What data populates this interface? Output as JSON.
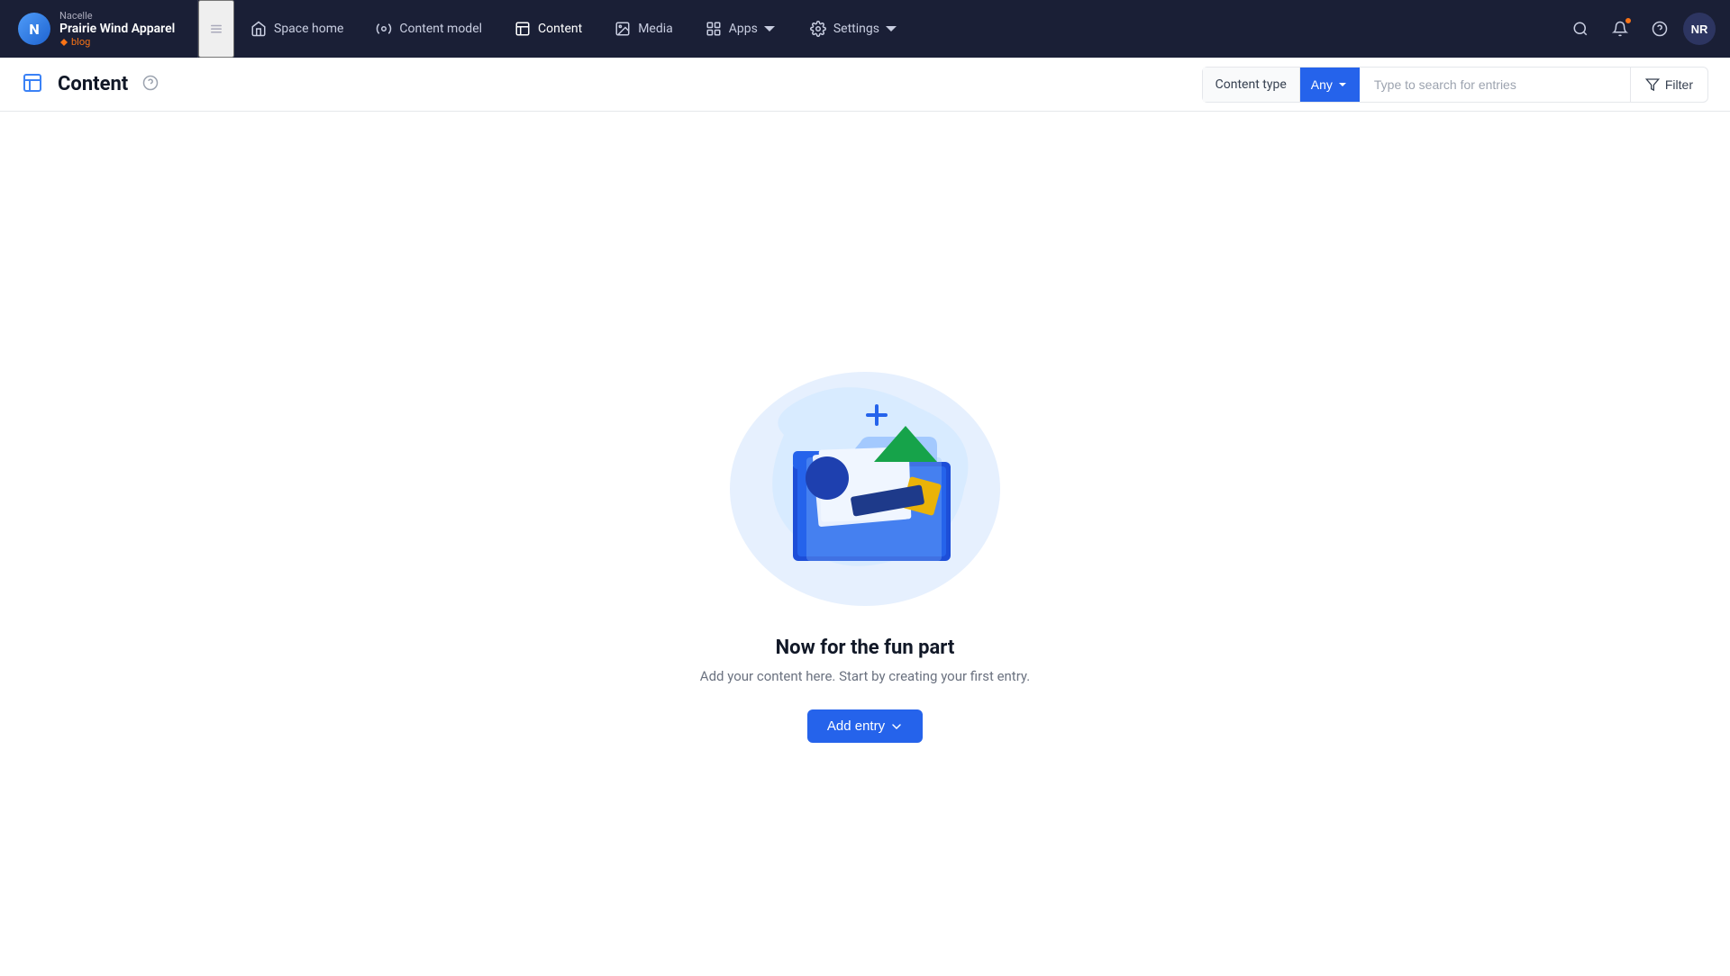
{
  "brand": {
    "nacelle_label": "Nacelle",
    "company": "Prairie Wind Apparel",
    "blog": "blog",
    "logo_initials": "N"
  },
  "nav": {
    "hamburger_label": "☰",
    "items": [
      {
        "id": "space-home",
        "label": "Space home",
        "icon": "home-icon"
      },
      {
        "id": "content-model",
        "label": "Content model",
        "icon": "content-model-icon"
      },
      {
        "id": "content",
        "label": "Content",
        "icon": "content-icon"
      },
      {
        "id": "media",
        "label": "Media",
        "icon": "media-icon"
      },
      {
        "id": "apps",
        "label": "Apps",
        "icon": "apps-icon",
        "has_dropdown": true
      },
      {
        "id": "settings",
        "label": "Settings",
        "icon": "settings-icon",
        "has_dropdown": true
      }
    ],
    "avatar": "NR"
  },
  "subheader": {
    "page_title": "Content",
    "content_type_label": "Content type",
    "any_label": "Any",
    "search_placeholder": "Type to search for entries",
    "filter_label": "Filter"
  },
  "empty_state": {
    "title": "Now for the fun part",
    "subtitle": "Add your content here. Start by creating your first entry.",
    "add_entry_label": "Add entry"
  }
}
